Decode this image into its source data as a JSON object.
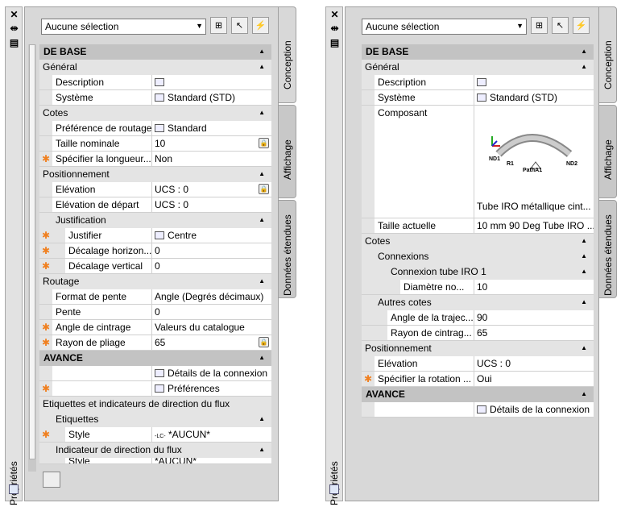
{
  "left": {
    "palette_title": "Propriétés",
    "selection": "Aucune sélection",
    "tabs": [
      "Conception",
      "Affichage",
      "Données étendues"
    ],
    "sections": {
      "de_base": "DE BASE",
      "general": "Général",
      "description": "Description",
      "systeme": "Système",
      "systeme_val": "Standard (STD)",
      "cotes": "Cotes",
      "pref_routage": "Préférence de routage",
      "pref_routage_val": "Standard",
      "taille_nominale": "Taille nominale",
      "taille_nominale_val": "10",
      "specifier_longueur": "Spécifier la longueur...",
      "specifier_longueur_val": "Non",
      "positionnement": "Positionnement",
      "elevation": "Elévation",
      "elevation_val": "UCS : 0",
      "elev_depart": "Elévation de départ",
      "elev_depart_val": "UCS : 0",
      "justification": "Justification",
      "justifier": "Justifier",
      "justifier_val": "Centre",
      "decal_horiz": "Décalage horizon...",
      "decal_horiz_val": "0",
      "decal_vert": "Décalage vertical",
      "decal_vert_val": "0",
      "routage": "Routage",
      "format_pente": "Format de pente",
      "format_pente_val": "Angle (Degrés décimaux)",
      "pente": "Pente",
      "pente_val": "0",
      "angle_cintrage": "Angle de cintrage",
      "angle_cintrage_val": "Valeurs du catalogue",
      "rayon_pliage": "Rayon de pliage",
      "rayon_pliage_val": "65",
      "avance": "AVANCE",
      "details_connexion": "Détails de la connexion",
      "preferences": "Préférences",
      "etiquettes_flux": "Etiquettes et indicateurs de direction du flux",
      "etiquettes": "Etiquettes",
      "style": "Style",
      "style_val": "*AUCUN*",
      "style_prefix": "-LC-",
      "indicateur_flux": "Indicateur de direction du flux",
      "cut_label": "Style",
      "cut_val": "*AUCUN*"
    }
  },
  "right": {
    "palette_title": "Propriétés",
    "selection": "Aucune sélection",
    "tabs": [
      "Conception",
      "Affichage",
      "Données étendues"
    ],
    "sections": {
      "de_base": "DE BASE",
      "general": "Général",
      "description": "Description",
      "systeme": "Système",
      "systeme_val": "Standard (STD)",
      "composant": "Composant",
      "composant_val": "Tube IRO métallique cint...",
      "comp_nd1": "ND1",
      "comp_r1": "R1",
      "comp_patha1": "PathA1",
      "comp_nd2": "ND2",
      "taille_actuelle": "Taille actuelle",
      "taille_actuelle_val": "10 mm 90 Deg Tube IRO ...",
      "cotes": "Cotes",
      "connexions": "Connexions",
      "connexion_tube": "Connexion tube IRO 1",
      "diametre": "Diamètre no...",
      "diametre_val": "10",
      "autres_cotes": "Autres cotes",
      "angle_traj": "Angle de la trajec...",
      "angle_traj_val": "90",
      "rayon_cintrag": "Rayon de cintrag...",
      "rayon_cintrag_val": "65",
      "positionnement": "Positionnement",
      "elevation": "Elévation",
      "elevation_val": "UCS : 0",
      "specifier_rotation": "Spécifier la rotation ...",
      "specifier_rotation_val": "Oui",
      "avance": "AVANCE",
      "details_connexion": "Détails de la connexion"
    }
  },
  "colors": {
    "star": "#f08020",
    "cat1": "#c3c3c3",
    "cat2": "#e4e4e4"
  },
  "icons": [
    "close-icon",
    "autohide-icon",
    "menu-icon",
    "quick-select-icon",
    "select-objects-icon",
    "toggle-pickadd-icon"
  ]
}
